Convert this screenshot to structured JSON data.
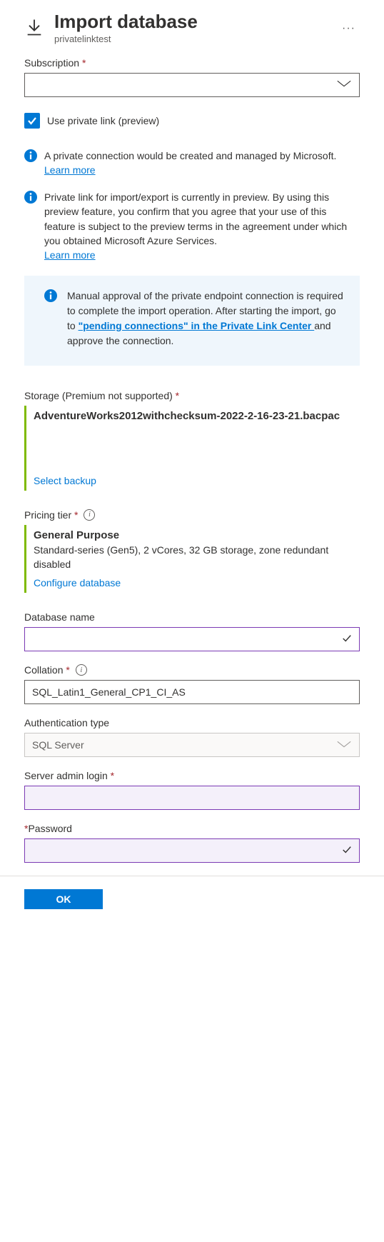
{
  "header": {
    "title": "Import database",
    "subtitle": "privatelinktest"
  },
  "subscription": {
    "label": "Subscription"
  },
  "usePrivateLink": {
    "label": "Use private link (preview)"
  },
  "info1": {
    "text": "A private connection would be created and managed by Microsoft.",
    "learn": "Learn more"
  },
  "info2": {
    "text": "Private link for import/export is currently in preview. By using this preview feature, you confirm that you agree that your use of this feature is subject to the preview terms in the agreement under which you obtained Microsoft Azure Services.",
    "learn": "Learn more"
  },
  "callout": {
    "pre": "Manual approval of the private endpoint connection is required to complete the import operation. After starting the import, go to ",
    "linkText": "\"pending connections\" in the Private Link Center ",
    "post": "and approve the connection."
  },
  "storage": {
    "label": "Storage (Premium not supported)",
    "filename": "AdventureWorks2012withchecksum-2022-2-16-23-21.bacpac",
    "action": "Select backup"
  },
  "pricing": {
    "label": "Pricing tier",
    "tierName": "General Purpose",
    "details": "Standard-series (Gen5), 2 vCores, 32 GB storage, zone redundant disabled",
    "action": "Configure database"
  },
  "dbName": {
    "label": "Database name"
  },
  "collation": {
    "label": "Collation",
    "value": "SQL_Latin1_General_CP1_CI_AS"
  },
  "authType": {
    "label": "Authentication type",
    "value": "SQL Server"
  },
  "adminLogin": {
    "label": "Server admin login"
  },
  "password": {
    "label": "Password"
  },
  "footer": {
    "ok": "OK"
  }
}
